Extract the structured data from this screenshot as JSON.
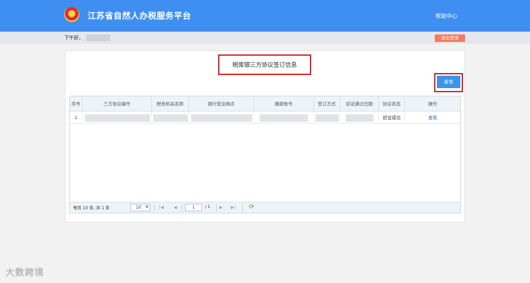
{
  "header": {
    "title": "江苏省自然人办税服务平台",
    "help_label": "帮助中心"
  },
  "userbar": {
    "greeting": "下午好，",
    "logout_label": "退出登录"
  },
  "page": {
    "title": "税库银三方协议签订信息",
    "add_label": "新增"
  },
  "table": {
    "columns": [
      "序号",
      "三方协议编号",
      "税务机关名称",
      "银行营业网点",
      "缴款账号",
      "签订方式",
      "验证通过日期",
      "协议状态",
      "操作"
    ],
    "rows": [
      {
        "index": "1",
        "status": "验证成功",
        "action": "查看"
      }
    ]
  },
  "pager": {
    "summary": "每页 10 条, 共 1 条",
    "page_size": "10",
    "current_page": "1",
    "total_pages": "/ 1"
  },
  "watermark": "大数跨境"
}
